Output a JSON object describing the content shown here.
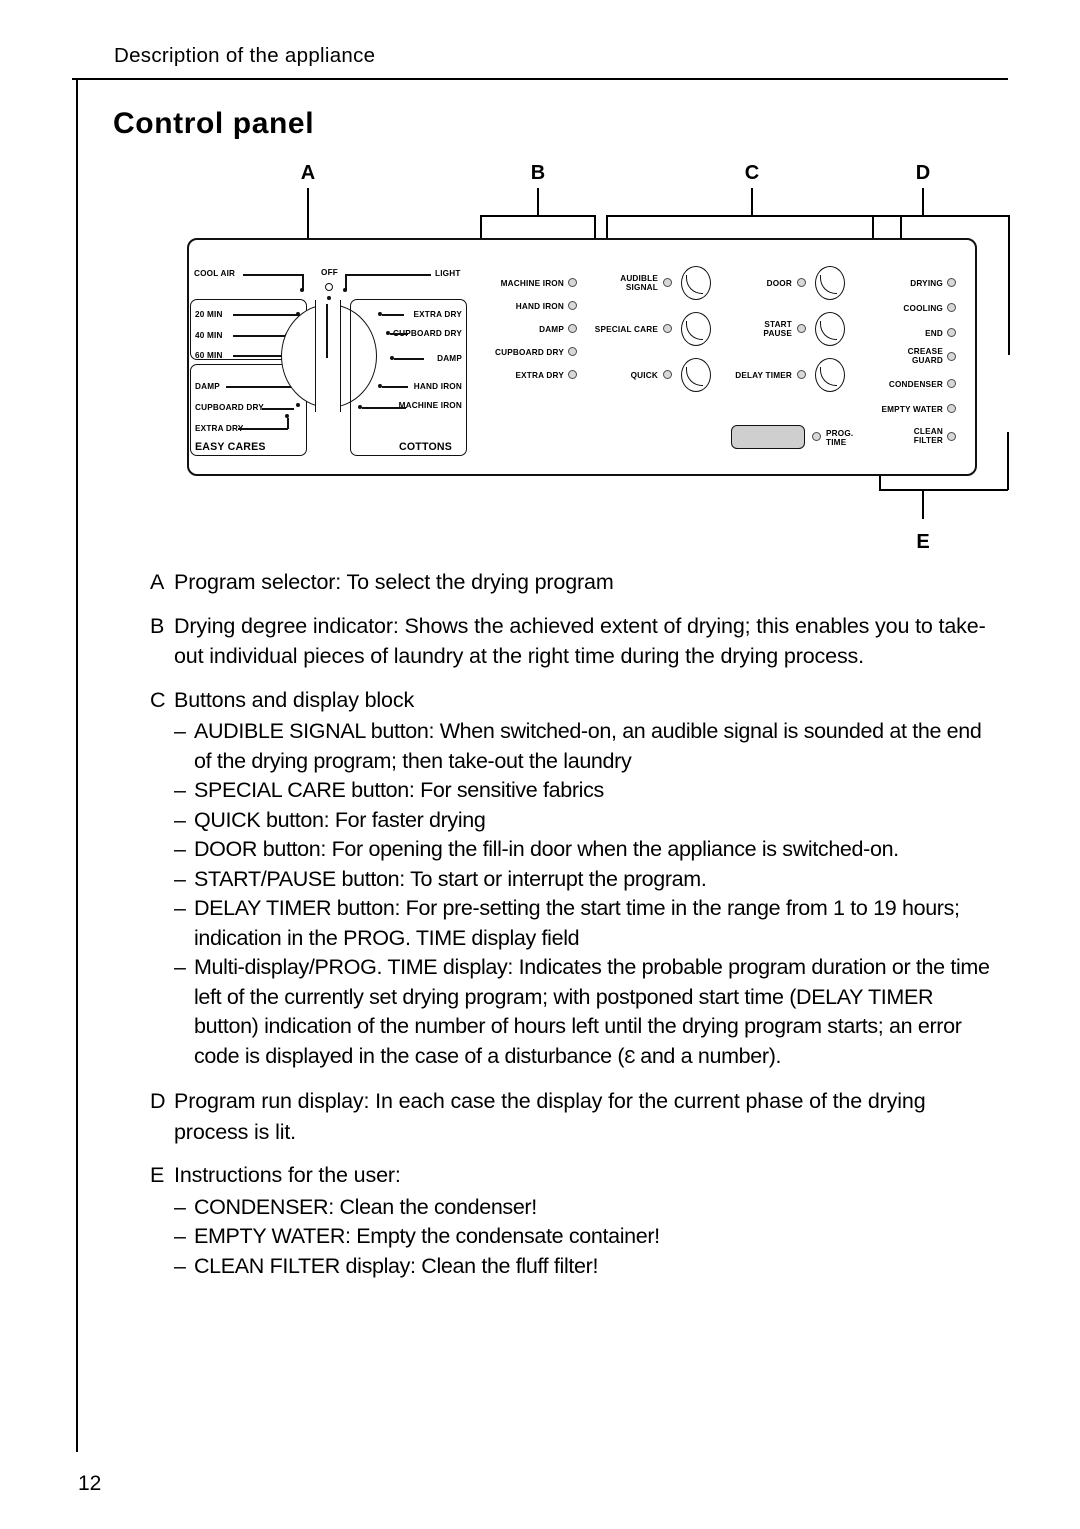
{
  "header": {
    "running_head": "Description of the appliance",
    "page_number": "12"
  },
  "title": "Control panel",
  "callouts": {
    "a": "A",
    "b": "B",
    "c": "C",
    "d": "D",
    "e": "E"
  },
  "panel": {
    "selector": {
      "off": "OFF",
      "cool_air": "COOL AIR",
      "light": "LIGHT",
      "timed": [
        "20 MIN",
        "40 MIN",
        "60 MIN"
      ],
      "easy_cares_settings": [
        "DAMP",
        "CUPBOARD DRY",
        "EXTRA DRY"
      ],
      "easy_cares_label": "EASY CARES",
      "cottons_settings": [
        "EXTRA DRY",
        "CUPBOARD DRY",
        "DAMP",
        "HAND IRON",
        "MACHINE IRON"
      ],
      "cottons_label": "COTTONS"
    },
    "drying_degree": [
      "MACHINE IRON",
      "HAND IRON",
      "DAMP",
      "CUPBOARD DRY",
      "EXTRA DRY"
    ],
    "buttons_left": [
      "AUDIBLE SIGNAL",
      "SPECIAL CARE",
      "QUICK"
    ],
    "buttons_right": [
      "DOOR",
      "START PAUSE",
      "DELAY TIMER"
    ],
    "prog_time_label": "PROG. TIME",
    "run_display": [
      "DRYING",
      "COOLING",
      "END",
      "CREASE GUARD",
      "CONDENSER",
      "EMPTY WATER",
      "CLEAN FILTER"
    ]
  },
  "descriptions": [
    {
      "mark": "A",
      "text": "Program selector: To select the drying program"
    },
    {
      "mark": "B",
      "text": "Drying degree indicator: Shows the achieved extent of drying; this enables you to take-out individual pieces of laundry at the right time during the drying process."
    },
    {
      "mark": "C",
      "text": "Buttons and display block"
    },
    {
      "mark": "D",
      "text": "Program run display: In each case the display for the current phase of the drying process is lit."
    },
    {
      "mark": "E",
      "text": "Instructions for the user:"
    }
  ],
  "c_items": [
    {
      "mark": "–",
      "text": "AUDIBLE SIGNAL button: When switched-on, an audible signal is sounded at the end of the drying program; then take-out the laundry"
    },
    {
      "mark": "–",
      "text": "SPECIAL CARE button: For sensitive fabrics"
    },
    {
      "mark": "–",
      "text": "QUICK button: For faster drying"
    },
    {
      "mark": "–",
      "text": "DOOR button: For opening the fill-in door when the appliance is switched-on."
    },
    {
      "mark": "–",
      "text": "START/PAUSE button: To start or interrupt the program."
    },
    {
      "mark": "–",
      "text": "DELAY TIMER button: For pre-setting the start time in the range from 1 to 19 hours; indication in the PROG. TIME display field"
    }
  ],
  "c_multidisplay": {
    "mark": "–",
    "part1": "Multi-display/PROG. TIME display: Indicates the probable program duration or the time left of the currently set drying program; with postponed start time (DELAY TIMER button) indication of the number of hours left until the drying program starts; an error code is displayed in the case of a disturbance (",
    "error_glyph": "Ɛ",
    "part2": " and a number)."
  },
  "e_items": [
    {
      "mark": "–",
      "text": "CONDENSER: Clean the condenser!"
    },
    {
      "mark": "–",
      "text": "EMPTY WATER: Empty the condensate container!"
    },
    {
      "mark": "–",
      "text": "CLEAN FILTER display: Clean the fluff filter!"
    }
  ]
}
